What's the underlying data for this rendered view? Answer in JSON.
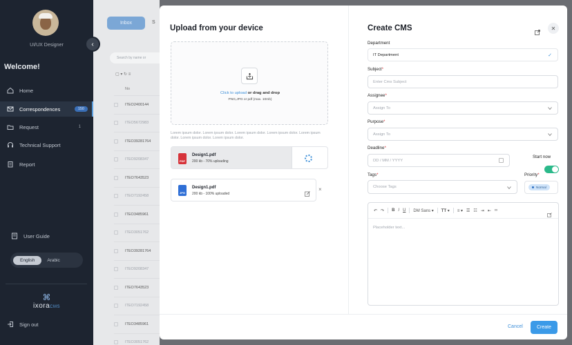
{
  "sidebar": {
    "role": "UI/UX Designer",
    "welcome": "Welcome!",
    "items": [
      {
        "label": "Home",
        "icon": "home-icon"
      },
      {
        "label": "Correspondences",
        "icon": "mail-icon",
        "badge": "150"
      },
      {
        "label": "Request",
        "icon": "folder-icon",
        "count": "1"
      },
      {
        "label": "Technical Support",
        "icon": "headset-icon"
      },
      {
        "label": "Report",
        "icon": "clipboard-icon"
      }
    ],
    "user_guide": "User Guide",
    "languages": [
      "English",
      "Arabic"
    ],
    "logo_text": "ixora",
    "logo_suffix": "CMS",
    "sign_out": "Sign out",
    "accent_color": "#5b9fe0"
  },
  "background": {
    "tabs": [
      "Inbox",
      "S"
    ],
    "search_placeholder": "Search by name or",
    "column_header": "No",
    "rows": [
      "ITEO2400144",
      "ITEO5672983",
      "ITEO39281764",
      "ITEO9208347",
      "ITEO7643523",
      "ITEO7192458",
      "ITEO3485961",
      "ITEO3051762",
      "ITEO39281764",
      "ITEO9208347",
      "ITEO7643523",
      "ITEO7192458",
      "ITEO3485961",
      "ITEO3051762"
    ]
  },
  "upload": {
    "title": "Upload from your device",
    "click_text": "Click to upload",
    "drag_text": " or drag and drop",
    "hint": "PNG,JPG or pdf (max. 10mb)",
    "lorem": "Lorem ipsum dolor. Lorem ipsum dolor. Lorem ipsum dolor. Lorem ipsum dolor. Lorem ipsum dolor. Lorem ipsum dolor. Lorem ipsum dolor.",
    "files": [
      {
        "name": "Design1.pdf",
        "meta": "200 kb - 70% uploading",
        "type": "PDF",
        "progress": 0.7
      },
      {
        "name": "Design1.pdf",
        "meta": "200 kb - 100% uploaded",
        "type": "JPG",
        "progress": 1.0
      }
    ]
  },
  "form": {
    "title": "Create CMS",
    "department_label": "Department",
    "department_value": "IT Department",
    "subject_label": "Subject",
    "subject_placeholder": "Enter Cms Subject",
    "assignee_label": "Assignee",
    "assignee_placeholder": "Assign To",
    "purpose_label": "Purpose",
    "purpose_placeholder": "Assign To",
    "deadline_label": "Deadline",
    "deadline_placeholder": "DD / MM / YYYY",
    "start_now_label": "Start now",
    "start_now_on": true,
    "tags_label": "Tags",
    "tags_placeholder": "Choose Tags",
    "priority_label": "Priority",
    "priority_value": "Normal",
    "req_mark": "*",
    "editor": {
      "font": "DM Sans",
      "placeholder": "Placeholder text..."
    },
    "cancel": "Cancel",
    "create": "Create",
    "primary_color": "#3b9ae8",
    "toggle_color": "#2bb98a"
  }
}
